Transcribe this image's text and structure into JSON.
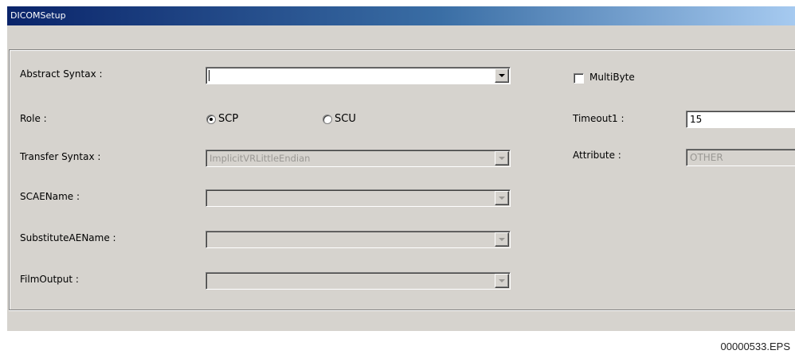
{
  "window": {
    "title": "DICOMSetup"
  },
  "form": {
    "abstract_syntax": {
      "label": "Abstract Syntax :",
      "value": ""
    },
    "role": {
      "label": "Role :",
      "options": [
        "SCP",
        "SCU"
      ],
      "selected": "SCP"
    },
    "transfer_syntax": {
      "label": "Transfer Syntax :",
      "value": "ImplicitVRLittleEndian"
    },
    "scae_name": {
      "label": "SCAEName :",
      "value": ""
    },
    "substitute_ae_name": {
      "label": "SubstituteAEName :",
      "value": ""
    },
    "film_output": {
      "label": "FilmOutput :",
      "value": ""
    },
    "multibyte": {
      "label": "MultiByte",
      "checked": false
    },
    "timeout1": {
      "label": "Timeout1 :",
      "value": "15"
    },
    "attribute": {
      "label": "Attribute :",
      "value": "OTHER"
    }
  },
  "footer": {
    "filename": "00000533.EPS"
  },
  "icons": {
    "dropdown": "chevron-down-icon",
    "radio": "radio-icon",
    "checkbox": "checkbox-icon"
  }
}
